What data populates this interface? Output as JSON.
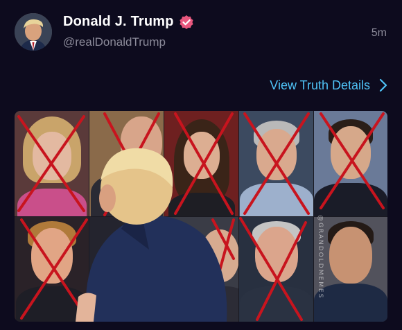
{
  "post": {
    "author": {
      "display_name": "Donald J. Trump",
      "handle": "@realDonaldTrump",
      "verified": true,
      "avatar_icon": "profile-photo"
    },
    "timestamp": "5m",
    "details_link": {
      "label": "View Truth Details",
      "icon": "chevron-right-icon"
    },
    "media": {
      "type": "photo-collage",
      "rows": 2,
      "columns": 5,
      "watermark": "@GRANDOLDMEMES",
      "crossed_out_tiles": 8
    }
  },
  "colors": {
    "background": "#0d0b1e",
    "link": "#4fc3f7",
    "verified_badge": "#e8577e",
    "muted_text": "#8b8a99",
    "cross_mark": "#c8141e"
  }
}
